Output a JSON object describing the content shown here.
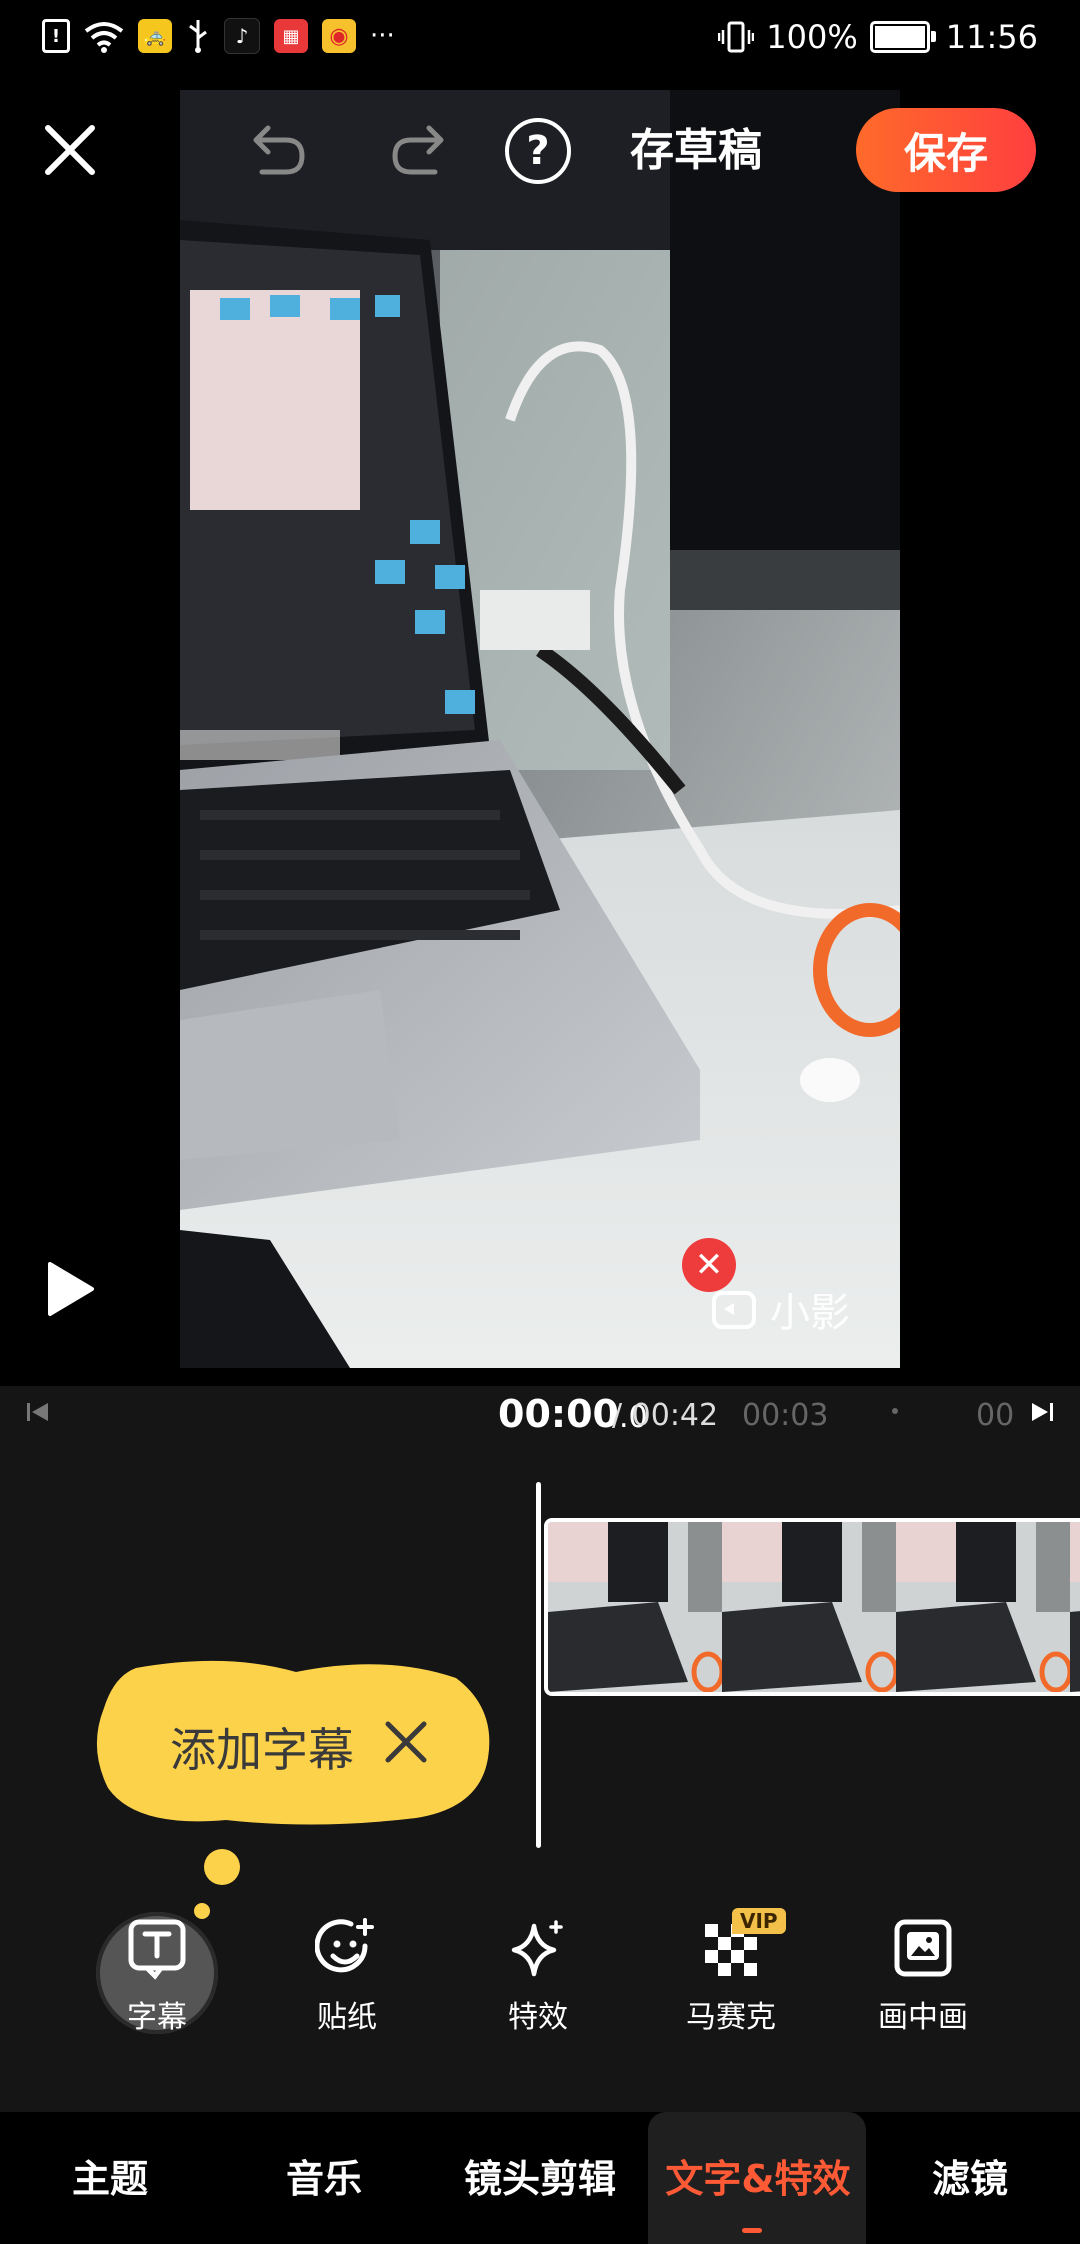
{
  "status_bar": {
    "battery_text": "100%",
    "time": "11:56",
    "more": "···",
    "battery_level": 1.0
  },
  "header": {
    "draft_label": "存草稿",
    "save_label": "保存"
  },
  "watermark": {
    "text": "小影"
  },
  "timeline": {
    "current_time": "00:00",
    "current_time_decimal": ".0",
    "total_time": "/ 00:42",
    "mark1": "00:03",
    "mark2": "00"
  },
  "tooltip": {
    "text": "添加字幕"
  },
  "tools": [
    {
      "label": "字幕",
      "icon": "subtitle-icon"
    },
    {
      "label": "贴纸",
      "icon": "sticker-icon"
    },
    {
      "label": "特效",
      "icon": "sparkle-icon"
    },
    {
      "label": "马赛克",
      "icon": "mosaic-icon",
      "badge": "VIP"
    },
    {
      "label": "画中画",
      "icon": "picture-in-picture-icon"
    }
  ],
  "bottom_nav": [
    {
      "label": "主题"
    },
    {
      "label": "音乐"
    },
    {
      "label": "镜头剪辑"
    },
    {
      "label": "文字&特效",
      "active": true
    },
    {
      "label": "滤镜"
    }
  ],
  "colors": {
    "accent": "#ff5a36",
    "save_gradient_start": "#ff6a2a",
    "save_gradient_end": "#ff3f3f",
    "tooltip": "#fdd24b",
    "vip": "#f3c14a"
  }
}
